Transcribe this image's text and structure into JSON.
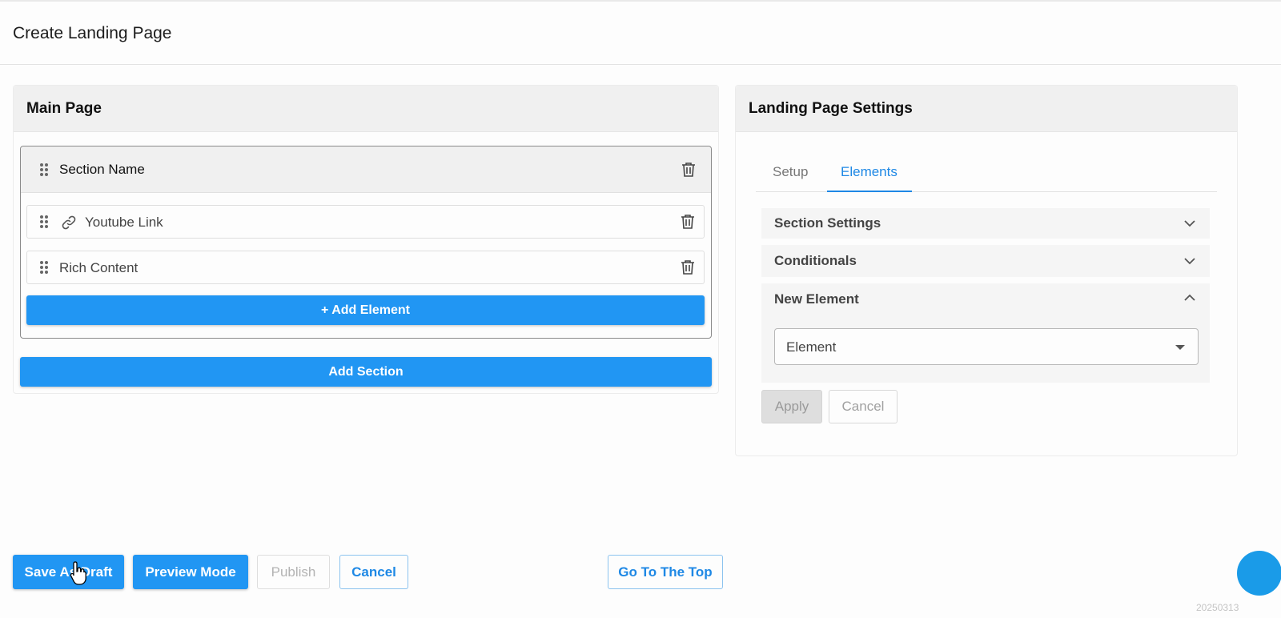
{
  "page": {
    "title": "Create Landing Page",
    "build_id": "20250313"
  },
  "main_page": {
    "title": "Main Page",
    "section": {
      "name": "Section Name",
      "elements": [
        {
          "label": "Youtube Link",
          "icon": "link-icon"
        },
        {
          "label": "Rich Content"
        }
      ],
      "add_element_label": "+ Add Element"
    },
    "add_section_label": "Add Section"
  },
  "settings": {
    "title": "Landing Page Settings",
    "tabs": [
      {
        "label": "Setup",
        "active": false
      },
      {
        "label": "Elements",
        "active": true
      }
    ],
    "accordions": [
      {
        "title": "Section Settings",
        "expanded": false
      },
      {
        "title": "Conditionals",
        "expanded": false
      },
      {
        "title": "New Element",
        "expanded": true
      }
    ],
    "element_select": {
      "value": "Element"
    },
    "apply_label": "Apply",
    "cancel_label": "Cancel"
  },
  "footer": {
    "save_draft_label": "Save As Draft",
    "preview_label": "Preview Mode",
    "publish_label": "Publish",
    "cancel_label": "Cancel",
    "go_top_label": "Go To The Top"
  },
  "colors": {
    "primary": "#2196f3",
    "link": "#1e88e5",
    "header_bg": "#f0f0f0"
  }
}
